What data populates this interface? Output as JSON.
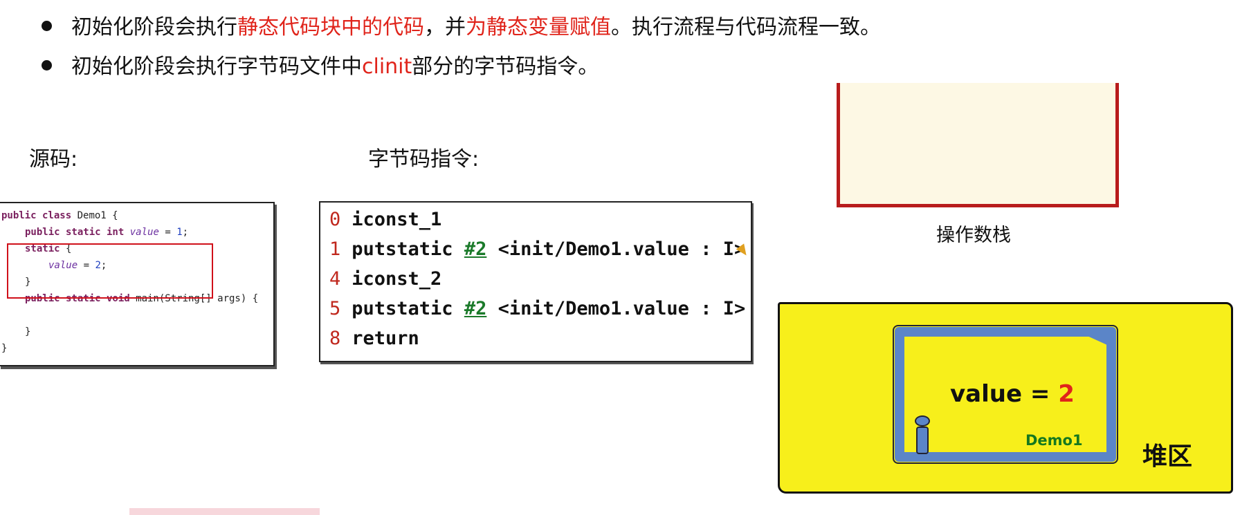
{
  "bullets": [
    {
      "parts": [
        {
          "text": "初始化阶段会执行",
          "color": "black"
        },
        {
          "text": "静态代码块中的代码",
          "color": "red"
        },
        {
          "text": "，并",
          "color": "black"
        },
        {
          "text": "为静态变量赋值",
          "color": "red"
        },
        {
          "text": "。执行流程与代码流程一致。",
          "color": "black"
        }
      ]
    },
    {
      "parts": [
        {
          "text": "初始化阶段会执行字节码文件中",
          "color": "black"
        },
        {
          "text": "clinit",
          "color": "red"
        },
        {
          "text": "部分的字节码指令。",
          "color": "black"
        }
      ]
    }
  ],
  "labels": {
    "source": "源码:",
    "bytecode": "字节码指令:",
    "operand_stack": "操作数栈",
    "heap": "堆区"
  },
  "source_code": {
    "line1": {
      "kw": "public class",
      "rest": " Demo1 {"
    },
    "line2": {
      "kw": "public static int",
      "var": "value",
      "rest": " = ",
      "num": "1",
      "end": ";"
    },
    "line3": {
      "kw": "static",
      "rest": " {"
    },
    "line4": {
      "var": "value",
      "rest": " = ",
      "num": "2",
      "end": ";"
    },
    "line5": "}",
    "line6": {
      "kw": "public static void",
      "rest": " main(String[] args) {"
    },
    "line7": "}",
    "line8": "}"
  },
  "bytecode": [
    {
      "idx": "0",
      "op": "iconst_1",
      "ref": "",
      "rest": ""
    },
    {
      "idx": "1",
      "op": "putstatic ",
      "ref": "#2",
      "rest": " <init/Demo1.value : I>"
    },
    {
      "idx": "4",
      "op": "iconst_2",
      "ref": "",
      "rest": ""
    },
    {
      "idx": "5",
      "op": "putstatic ",
      "ref": "#2",
      "rest": " <init/Demo1.value : I>"
    },
    {
      "idx": "8",
      "op": "return",
      "ref": "",
      "rest": ""
    }
  ],
  "heap_object": {
    "value_label": "value = ",
    "value": "2",
    "class_name": "Demo1"
  },
  "colors": {
    "accent_red": "#e0241b",
    "heap_yellow": "#f7ef1b",
    "object_blue": "#5b85c8",
    "class_green": "#15781f",
    "stack_border": "#b81c1c"
  }
}
